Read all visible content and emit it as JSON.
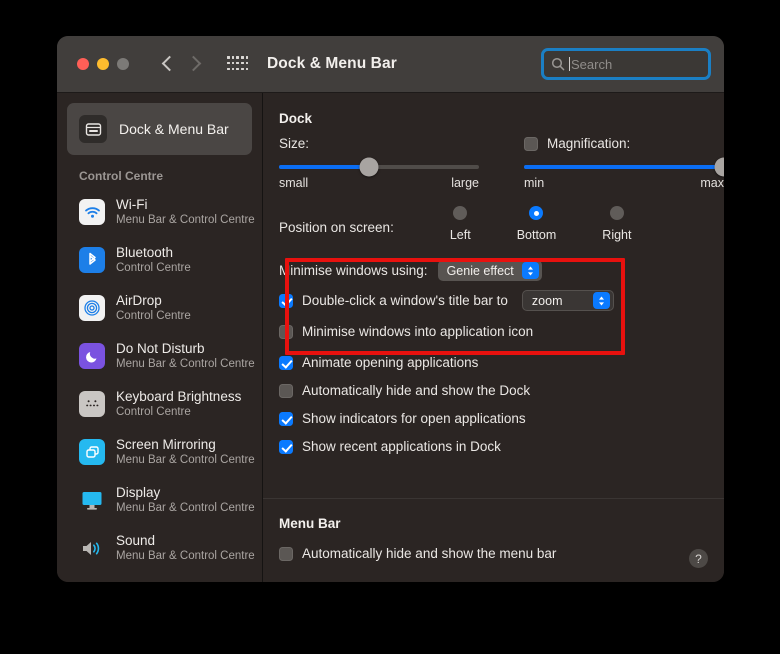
{
  "window": {
    "title": "Dock & Menu Bar",
    "traffic_lights": [
      "close",
      "minimize",
      "zoom"
    ],
    "nav": {
      "back": "back-chevron",
      "forward": "forward-chevron"
    },
    "grid_button": "show-all-icon",
    "search": {
      "placeholder": "Search",
      "value": "",
      "focused": true
    }
  },
  "sidebar": {
    "selected": {
      "label": "Dock & Menu Bar",
      "icon": "dock-menu-bar-icon"
    },
    "section_header": "Control Centre",
    "items": [
      {
        "label": "Wi-Fi",
        "sub": "Menu Bar & Control Centre",
        "icon": "wifi-icon"
      },
      {
        "label": "Bluetooth",
        "sub": "Control Centre",
        "icon": "bluetooth-icon"
      },
      {
        "label": "AirDrop",
        "sub": "Control Centre",
        "icon": "airdrop-icon"
      },
      {
        "label": "Do Not Disturb",
        "sub": "Menu Bar & Control Centre",
        "icon": "do-not-disturb-icon"
      },
      {
        "label": "Keyboard Brightness",
        "sub": "Control Centre",
        "icon": "keyboard-brightness-icon"
      },
      {
        "label": "Screen Mirroring",
        "sub": "Menu Bar & Control Centre",
        "icon": "screen-mirroring-icon"
      },
      {
        "label": "Display",
        "sub": "Menu Bar & Control Centre",
        "icon": "display-icon"
      },
      {
        "label": "Sound",
        "sub": "Menu Bar & Control Centre",
        "icon": "sound-icon"
      }
    ]
  },
  "dock": {
    "section_title": "Dock",
    "size": {
      "label": "Size:",
      "min_label": "small",
      "max_label": "large",
      "value_percent": 45
    },
    "magnification": {
      "label": "Magnification:",
      "checked": false,
      "min_label": "min",
      "max_label": "max",
      "value_percent": 100
    },
    "position": {
      "label": "Position on screen:",
      "options": [
        "Left",
        "Bottom",
        "Right"
      ],
      "selected": "Bottom"
    },
    "minimise_using": {
      "label": "Minimise windows using:",
      "value": "Genie effect"
    },
    "double_click": {
      "label": "Double-click a window's title bar to",
      "checked": true,
      "value": "zoom"
    },
    "minimise_into_icon": {
      "label": "Minimise windows into application icon",
      "checked": false
    },
    "animate_opening": {
      "label": "Animate opening applications",
      "checked": true
    },
    "auto_hide_dock": {
      "label": "Automatically hide and show the Dock",
      "checked": false
    },
    "show_indicators": {
      "label": "Show indicators for open applications",
      "checked": true
    },
    "show_recents": {
      "label": "Show recent applications in Dock",
      "checked": true
    }
  },
  "menu_bar": {
    "section_title": "Menu Bar",
    "auto_hide": {
      "label": "Automatically hide and show the menu bar",
      "checked": false
    },
    "help_label": "?"
  },
  "annotation": {
    "color": "#e8110e",
    "shape": "rectangle"
  }
}
